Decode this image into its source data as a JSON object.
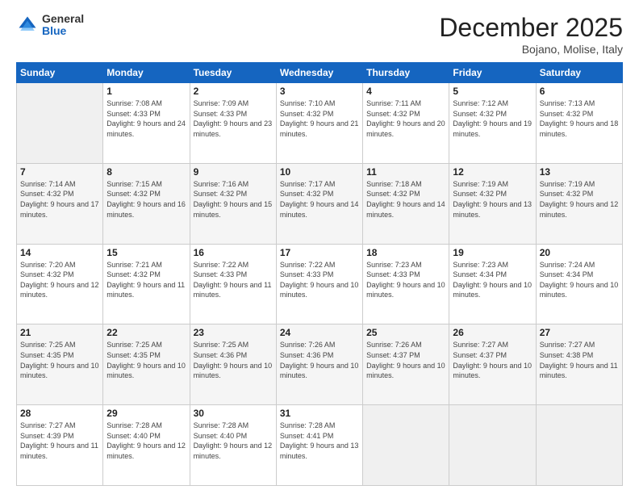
{
  "header": {
    "logo": {
      "general": "General",
      "blue": "Blue"
    },
    "title": "December 2025",
    "subtitle": "Bojano, Molise, Italy"
  },
  "days_of_week": [
    "Sunday",
    "Monday",
    "Tuesday",
    "Wednesday",
    "Thursday",
    "Friday",
    "Saturday"
  ],
  "weeks": [
    [
      {
        "day": "",
        "empty": true
      },
      {
        "day": "1",
        "sunrise": "7:08 AM",
        "sunset": "4:33 PM",
        "daylight": "9 hours and 24 minutes."
      },
      {
        "day": "2",
        "sunrise": "7:09 AM",
        "sunset": "4:33 PM",
        "daylight": "9 hours and 23 minutes."
      },
      {
        "day": "3",
        "sunrise": "7:10 AM",
        "sunset": "4:32 PM",
        "daylight": "9 hours and 21 minutes."
      },
      {
        "day": "4",
        "sunrise": "7:11 AM",
        "sunset": "4:32 PM",
        "daylight": "9 hours and 20 minutes."
      },
      {
        "day": "5",
        "sunrise": "7:12 AM",
        "sunset": "4:32 PM",
        "daylight": "9 hours and 19 minutes."
      },
      {
        "day": "6",
        "sunrise": "7:13 AM",
        "sunset": "4:32 PM",
        "daylight": "9 hours and 18 minutes."
      }
    ],
    [
      {
        "day": "7",
        "sunrise": "7:14 AM",
        "sunset": "4:32 PM",
        "daylight": "9 hours and 17 minutes."
      },
      {
        "day": "8",
        "sunrise": "7:15 AM",
        "sunset": "4:32 PM",
        "daylight": "9 hours and 16 minutes."
      },
      {
        "day": "9",
        "sunrise": "7:16 AM",
        "sunset": "4:32 PM",
        "daylight": "9 hours and 15 minutes."
      },
      {
        "day": "10",
        "sunrise": "7:17 AM",
        "sunset": "4:32 PM",
        "daylight": "9 hours and 14 minutes."
      },
      {
        "day": "11",
        "sunrise": "7:18 AM",
        "sunset": "4:32 PM",
        "daylight": "9 hours and 14 minutes."
      },
      {
        "day": "12",
        "sunrise": "7:19 AM",
        "sunset": "4:32 PM",
        "daylight": "9 hours and 13 minutes."
      },
      {
        "day": "13",
        "sunrise": "7:19 AM",
        "sunset": "4:32 PM",
        "daylight": "9 hours and 12 minutes."
      }
    ],
    [
      {
        "day": "14",
        "sunrise": "7:20 AM",
        "sunset": "4:32 PM",
        "daylight": "9 hours and 12 minutes."
      },
      {
        "day": "15",
        "sunrise": "7:21 AM",
        "sunset": "4:32 PM",
        "daylight": "9 hours and 11 minutes."
      },
      {
        "day": "16",
        "sunrise": "7:22 AM",
        "sunset": "4:33 PM",
        "daylight": "9 hours and 11 minutes."
      },
      {
        "day": "17",
        "sunrise": "7:22 AM",
        "sunset": "4:33 PM",
        "daylight": "9 hours and 10 minutes."
      },
      {
        "day": "18",
        "sunrise": "7:23 AM",
        "sunset": "4:33 PM",
        "daylight": "9 hours and 10 minutes."
      },
      {
        "day": "19",
        "sunrise": "7:23 AM",
        "sunset": "4:34 PM",
        "daylight": "9 hours and 10 minutes."
      },
      {
        "day": "20",
        "sunrise": "7:24 AM",
        "sunset": "4:34 PM",
        "daylight": "9 hours and 10 minutes."
      }
    ],
    [
      {
        "day": "21",
        "sunrise": "7:25 AM",
        "sunset": "4:35 PM",
        "daylight": "9 hours and 10 minutes."
      },
      {
        "day": "22",
        "sunrise": "7:25 AM",
        "sunset": "4:35 PM",
        "daylight": "9 hours and 10 minutes."
      },
      {
        "day": "23",
        "sunrise": "7:25 AM",
        "sunset": "4:36 PM",
        "daylight": "9 hours and 10 minutes."
      },
      {
        "day": "24",
        "sunrise": "7:26 AM",
        "sunset": "4:36 PM",
        "daylight": "9 hours and 10 minutes."
      },
      {
        "day": "25",
        "sunrise": "7:26 AM",
        "sunset": "4:37 PM",
        "daylight": "9 hours and 10 minutes."
      },
      {
        "day": "26",
        "sunrise": "7:27 AM",
        "sunset": "4:37 PM",
        "daylight": "9 hours and 10 minutes."
      },
      {
        "day": "27",
        "sunrise": "7:27 AM",
        "sunset": "4:38 PM",
        "daylight": "9 hours and 11 minutes."
      }
    ],
    [
      {
        "day": "28",
        "sunrise": "7:27 AM",
        "sunset": "4:39 PM",
        "daylight": "9 hours and 11 minutes."
      },
      {
        "day": "29",
        "sunrise": "7:28 AM",
        "sunset": "4:40 PM",
        "daylight": "9 hours and 12 minutes."
      },
      {
        "day": "30",
        "sunrise": "7:28 AM",
        "sunset": "4:40 PM",
        "daylight": "9 hours and 12 minutes."
      },
      {
        "day": "31",
        "sunrise": "7:28 AM",
        "sunset": "4:41 PM",
        "daylight": "9 hours and 13 minutes."
      },
      {
        "day": "",
        "empty": true
      },
      {
        "day": "",
        "empty": true
      },
      {
        "day": "",
        "empty": true
      }
    ]
  ],
  "labels": {
    "sunrise": "Sunrise:",
    "sunset": "Sunset:",
    "daylight": "Daylight:"
  }
}
